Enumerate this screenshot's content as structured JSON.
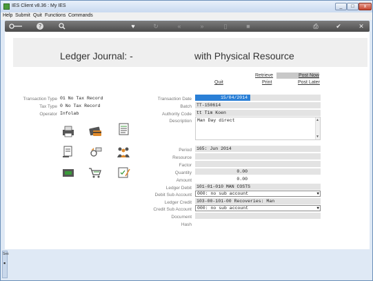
{
  "window": {
    "title": "IES Client v8.36 : My IES",
    "min": "_",
    "max": "□",
    "close": "x"
  },
  "menu": [
    "Help",
    "Submit",
    "Quit",
    "Functions",
    "Commands"
  ],
  "toolbar": {
    "icons": [
      "key-icon",
      "help-icon",
      "search-icon",
      "heart-icon",
      "refresh-icon",
      "back-icon",
      "forward-icon",
      "document-icon",
      "stop-icon",
      "print-icon",
      "check-icon",
      "close-icon"
    ]
  },
  "page": {
    "title_left": "Ledger Journal: -",
    "title_right": "with Physical Resource"
  },
  "actions": {
    "retrieve": "Retrieve",
    "post_now": "Post Now",
    "quit": "Quit",
    "print": "Print",
    "post_later": "Post Later"
  },
  "left_panel": {
    "transaction_type_label": "Transaction Type",
    "transaction_type_value": "01 No Tax Record",
    "tax_type_label": "Tax Type",
    "tax_type_value": "0 No Tax Record",
    "operator_label": "Operator",
    "operator_value": "Infolab"
  },
  "form": {
    "transaction_date_label": "Transaction Date",
    "transaction_date": "15/04/2014",
    "batch_label": "Batch",
    "batch": "TT-150614",
    "authority_label": "Authority Code",
    "authority": "tt Tim Koen",
    "description_label": "Description",
    "description": "Man Day direct",
    "period_label": "Period",
    "period": "165: Jun 2014",
    "resource_label": "Resource",
    "resource": "",
    "factor_label": "Factor",
    "factor": "",
    "quantity_label": "Quantity",
    "quantity": "0.00",
    "amount_label": "Amount",
    "amount": "0.00",
    "ledger_debit_label": "Ledger Debit",
    "ledger_debit": "101-01-010 MAN COSTS",
    "debit_sub_label": "Debit Sub Account",
    "debit_sub": "000: no sub account",
    "ledger_credit_label": "Ledger Credit",
    "ledger_credit": "103-00-101-00 Recoveries: Man",
    "credit_sub_label": "Credit Sub Account",
    "credit_sub": "000: no sub account",
    "document_label": "Document",
    "document": "",
    "hash_label": "Hash",
    "hash": ""
  },
  "status": {
    "side_label": "Ses"
  }
}
